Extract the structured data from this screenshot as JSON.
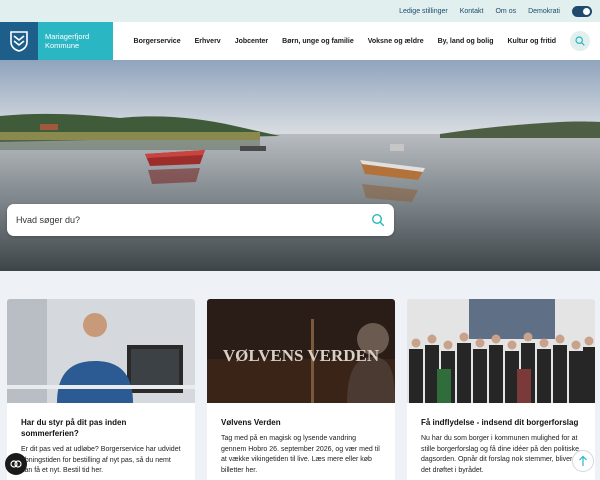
{
  "utility": {
    "links": [
      "Ledige stillinger",
      "Kontakt",
      "Om os",
      "Demokrati"
    ],
    "toggle_icon": "contrast-toggle-icon"
  },
  "header": {
    "logo_line1": "Mariagerfjord",
    "logo_line2": "Kommune",
    "nav": [
      "Borgerservice",
      "Erhverv",
      "Jobcenter",
      "Børn, unge og familie",
      "Voksne og ældre",
      "By, land og bolig",
      "Kultur og fritid"
    ],
    "search_icon": "search-icon"
  },
  "hero": {
    "search_placeholder": "Hvad søger du?"
  },
  "cards": [
    {
      "title": "Har du styr på dit pas inden sommerferien?",
      "text": "Er dit pas ved at udløbe? Borgerservice har udvidet åbningstiden for bestilling af nyt pas, så du nemt kan få et nyt. Bestil tid her."
    },
    {
      "title": "Vølvens Verden",
      "image_caption": "VØLVENS VERDEN",
      "text": "Tag med på en magisk og lysende vandring gennem Hobro 26. september 2026, og vær med til at vække vikingetiden til live. Læs mere eller køb billetter her."
    },
    {
      "title": "Få indflydelse - indsend dit borgerforslag",
      "text": "Nu har du som borger i kommunen mulighed for at stille borgerforslag og få dine idéer på den politiske dagsorden. Opnår dit forslag nok stemmer, bliver det drøftet i byrådet."
    }
  ],
  "colors": {
    "accent": "#2bb6c4",
    "brand_dark": "#1d5f8a",
    "utility_bg": "#e2efef"
  }
}
